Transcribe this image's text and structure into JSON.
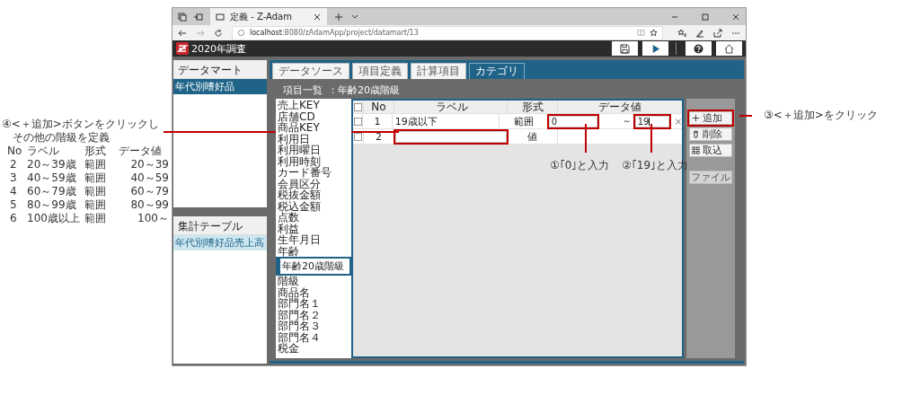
{
  "browser": {
    "tab_title": "定義 - Z-Adam",
    "url_host": "localhost",
    "url_path": ":8080/zAdamApp/project/datamart/13"
  },
  "app": {
    "title": "2020年調査"
  },
  "sidebar": {
    "panels": [
      {
        "title": "データマート",
        "active": true,
        "items": [
          {
            "label": "年代別嗜好品",
            "selected": true
          }
        ]
      },
      {
        "title": "集計テーブル",
        "active": false,
        "items": [
          {
            "label": "年代別嗜好品売上高",
            "selected": true
          }
        ]
      }
    ]
  },
  "tabs": [
    {
      "label": "データソース",
      "selected": false
    },
    {
      "label": "項目定義",
      "selected": false
    },
    {
      "label": "計算項目",
      "selected": false
    },
    {
      "label": "カテゴリ",
      "selected": true
    }
  ],
  "category": {
    "heading_label": "項目一覧",
    "heading_value": "：年齢20歳階級",
    "fields": [
      {
        "label": "売上KEY",
        "kind": "item"
      },
      {
        "label": "店舗CD",
        "kind": "item"
      },
      {
        "label": "商品KEY",
        "kind": "item"
      },
      {
        "label": "利用日",
        "kind": "item"
      },
      {
        "label": "利用曜日",
        "kind": "item"
      },
      {
        "label": "利用時刻",
        "kind": "item"
      },
      {
        "label": "カード番号",
        "kind": "item"
      },
      {
        "label": "会員区分",
        "kind": "item"
      },
      {
        "label": "税抜金額",
        "kind": "item"
      },
      {
        "label": "税込金額",
        "kind": "item"
      },
      {
        "label": "点数",
        "kind": "item"
      },
      {
        "label": "利益",
        "kind": "item"
      },
      {
        "label": "生年月日",
        "kind": "item"
      },
      {
        "label": "年齢",
        "kind": "item"
      },
      {
        "label": "年齢20歳階級",
        "kind": "input"
      },
      {
        "label": "階級",
        "kind": "item"
      },
      {
        "label": "商品名",
        "kind": "item"
      },
      {
        "label": "部門名１",
        "kind": "item"
      },
      {
        "label": "部門名２",
        "kind": "item"
      },
      {
        "label": "部門名３",
        "kind": "item"
      },
      {
        "label": "部門名４",
        "kind": "item"
      },
      {
        "label": "税金",
        "kind": "item"
      }
    ],
    "table": {
      "all_checked": false,
      "columns": [
        "No",
        "ラベル",
        "形式",
        "データ値"
      ],
      "rows": [
        {
          "checked": false,
          "no": "1",
          "label": "19歳以下",
          "type": "範囲",
          "value_from": "0",
          "separator": "～",
          "value_to": "19",
          "remove": "×"
        },
        {
          "checked": false,
          "no": "2",
          "type": "値",
          "label_highlighted": true
        }
      ]
    },
    "buttons": [
      {
        "label": "追加",
        "disabled": false,
        "highlighted": true
      },
      {
        "label": "削除",
        "disabled": false,
        "highlighted": false
      },
      {
        "label": "取込",
        "disabled": false,
        "highlighted": false
      },
      {
        "label": "ファイル",
        "disabled": true,
        "highlighted": false
      }
    ]
  },
  "annotations": {
    "step4": {
      "lines": [
        "④<＋追加>ボタンをクリックし",
        "その他の階級を定義"
      ],
      "columns": [
        "No",
        "ラベル",
        "形式",
        "データ値"
      ],
      "rows": [
        [
          "2",
          "20～39歳",
          "範囲",
          "20～39"
        ],
        [
          "3",
          "40～59歳",
          "範囲",
          "40～59"
        ],
        [
          "4",
          "60～79歳",
          "範囲",
          "60～79"
        ],
        [
          "5",
          "80～99歳",
          "範囲",
          "80～99"
        ],
        [
          "6",
          "100歳以上",
          "範囲",
          "100～"
        ]
      ]
    },
    "step1": "①｢0｣と入力",
    "step2": "②｢19｣と入力",
    "step3": "③<＋追加>をクリック"
  }
}
